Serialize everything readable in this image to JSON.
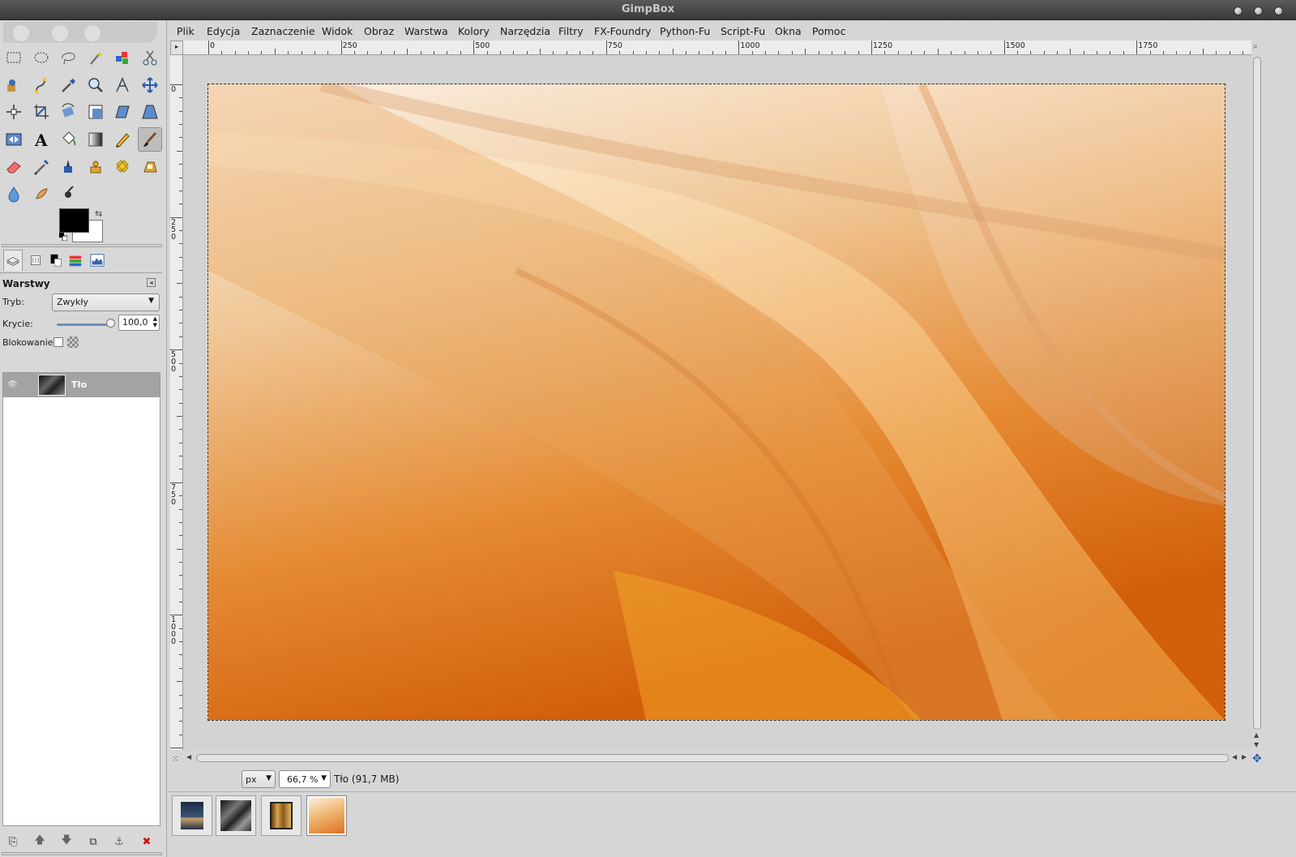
{
  "window": {
    "title": "GimpBox"
  },
  "menu": [
    "Plik",
    "Edycja",
    "Zaznaczenie",
    "Widok",
    "Obraz",
    "Warstwa",
    "Kolory",
    "Narzędzia",
    "Filtry",
    "FX-Foundry",
    "Python-Fu",
    "Script-Fu",
    "Okna",
    "Pomoc"
  ],
  "tools": [
    "rect-select-icon",
    "ellipse-select-icon",
    "lasso-icon",
    "fuzzy-select-icon",
    "color-select-icon",
    "scissors-icon",
    "foreground-select-icon",
    "paths-icon",
    "color-picker-icon",
    "zoom-icon",
    "measure-icon",
    "move-icon",
    "align-icon",
    "crop-icon",
    "rotate-icon",
    "scale-icon",
    "shear-icon",
    "perspective-icon",
    "flip-icon",
    "text-icon",
    "bucket-fill-icon",
    "blend-icon",
    "pencil-icon",
    "paintbrush-icon",
    "eraser-icon",
    "airbrush-icon",
    "ink-icon",
    "clone-icon",
    "heal-icon",
    "perspective-clone-icon",
    "blur-icon",
    "smudge-icon",
    "dodge-burn-icon"
  ],
  "colors": {
    "foreground": "#000000",
    "background": "#ffffff"
  },
  "layers_panel": {
    "title": "Warstwy",
    "mode_label": "Tryb:",
    "mode_value": "Zwykły",
    "opacity_label": "Krycie:",
    "opacity_value": "100,0",
    "lock_label": "Blokowanie:",
    "layers": [
      {
        "name": "Tło",
        "visible": true
      }
    ]
  },
  "rulers": {
    "horizontal": [
      "0",
      "250",
      "500",
      "750",
      "1000",
      "1250",
      "1500",
      "1750"
    ],
    "vertical": [
      "0",
      "250",
      "500",
      "750",
      "1000"
    ]
  },
  "status": {
    "unit": "px",
    "zoom": "66,7 %",
    "info": "Tło (91,7 MB)"
  },
  "images": [
    "night-sky-thumbnail",
    "dark-abstract-thumbnail",
    "golden-frame-thumbnail",
    "orange-wave-thumbnail"
  ]
}
